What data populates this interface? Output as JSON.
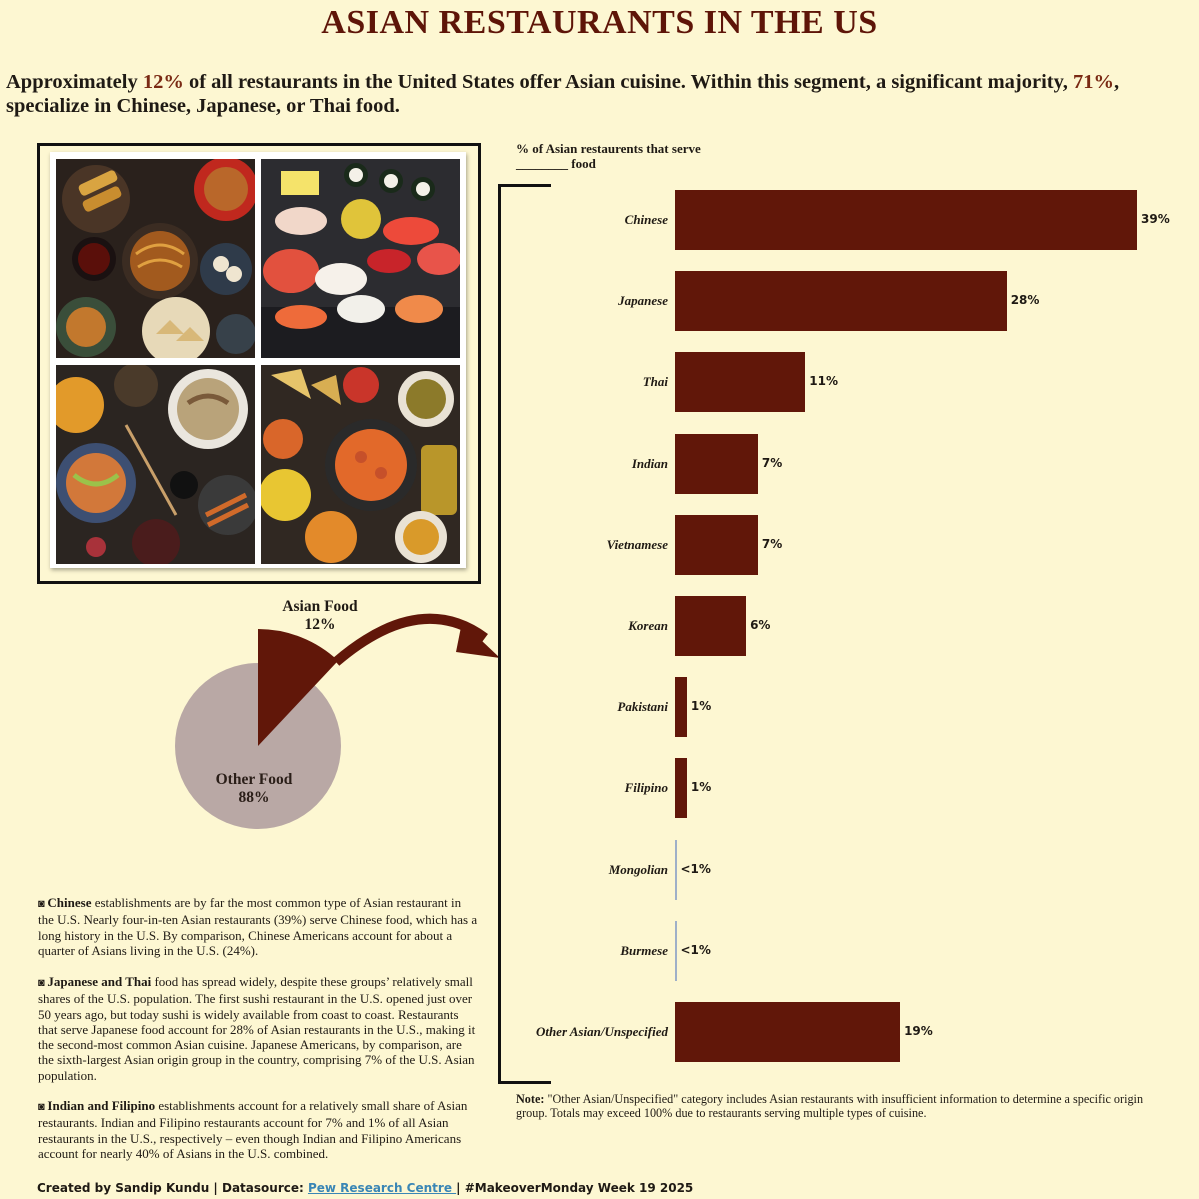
{
  "title": "ASIAN RESTAURANTS IN THE US",
  "subtitle": {
    "part1": "Approximately ",
    "pct1": "12%",
    "part2": " of all restaurants in the United States offer Asian cuisine. Within this segment, a significant majority, ",
    "pct2": "71%",
    "part3": ", specialize in Chinese, Japanese, or Thai food."
  },
  "colors": {
    "background": "#fdf7d2",
    "bar": "#611709",
    "title": "#5e1508",
    "pie_other": "#b9a8a5",
    "pie_asian": "#611709",
    "link": "#3a86b5"
  },
  "images": [
    "chinese-food-photo",
    "sushi-photo",
    "thai-vietnamese-food-photo",
    "indian-food-photo"
  ],
  "pie": {
    "asian_label": "Asian Food",
    "asian_value": "12%",
    "other_label": "Other Food",
    "other_value": "88%"
  },
  "chart_heading": "% of Asian restaurents that serve ________ food",
  "chart_data": [
    {
      "type": "pie",
      "labels": [
        "Asian Food",
        "Other Food"
      ],
      "values": [
        12,
        88
      ]
    },
    {
      "type": "bar",
      "orientation": "horizontal",
      "title": "% of Asian restaurents that serve ________ food",
      "categories": [
        "Chinese",
        "Japanese",
        "Thai",
        "Indian",
        "Vietnamese",
        "Korean",
        "Pakistani",
        "Filipino",
        "Mongolian",
        "Burmese",
        "Other Asian/Unspecified"
      ],
      "values": [
        39,
        28,
        11,
        7,
        7,
        6,
        1,
        1,
        0.1,
        0.1,
        19
      ],
      "value_labels": [
        "39%",
        "28%",
        "11%",
        "7%",
        "7%",
        "6%",
        "1%",
        "1%",
        "<1%",
        "<1%",
        "19%"
      ],
      "xlim": [
        0,
        39
      ]
    }
  ],
  "paragraphs": [
    {
      "bold": "Chinese",
      "text": " establishments are by far the most common type of Asian restaurant in the U.S. Nearly four-in-ten Asian restaurants (39%) serve Chinese food, which has a long history in the U.S. By comparison, Chinese Americans account for about a quarter of Asians living in the U.S. (24%)."
    },
    {
      "bold": "Japanese and Thai",
      "text": " food has spread widely, despite these groups’ relatively small shares of the U.S. population. The first sushi restaurant in the U.S. opened just over 50 years ago, but today sushi is widely available from coast to coast. Restaurants that serve Japanese food account for 28% of Asian restaurants in the U.S., making it the second-most common Asian cuisine. Japanese Americans, by comparison, are the sixth-largest Asian origin group in the country, comprising 7% of the U.S. Asian population."
    },
    {
      "bold": "Indian and Filipino",
      "text": " establishments account for a relatively small share of Asian restaurants. Indian and Filipino restaurants account for 7% and 1% of all Asian restaurants in the U.S., respectively – even though Indian and Filipino Americans account for nearly 40% of Asians in the U.S. combined."
    }
  ],
  "note": {
    "label": "Note:",
    "text": " \"Other Asian/Unspecified\" category includes Asian restaurants with insufficient information to determine a specific origin group. Totals may exceed 100% due to restaurants serving multiple types of cuisine."
  },
  "footer": {
    "created": "Created by Sandip Kundu | Datasource: ",
    "link_text": "Pew Research Centre ",
    "rest": " | #MakeoverMonday Week 19 2025"
  }
}
